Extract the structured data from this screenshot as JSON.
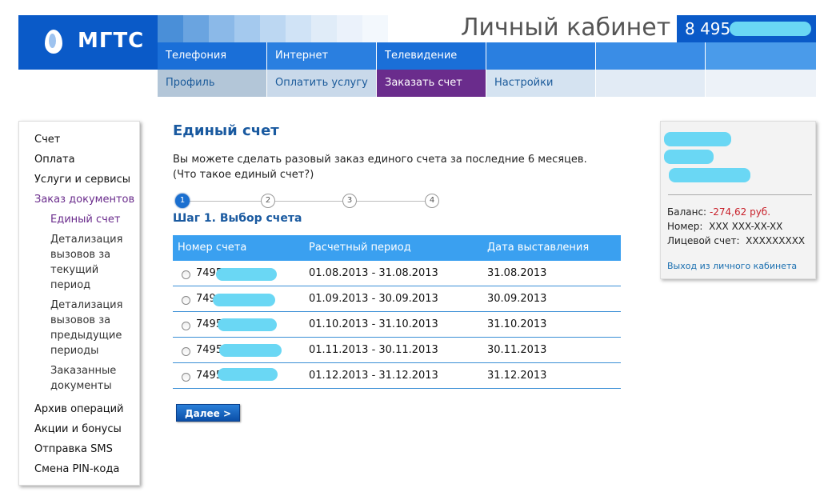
{
  "brand": {
    "logo_text": "МГТС",
    "brand_color": "#0a5ac8"
  },
  "header": {
    "title": "Личный кабинет",
    "phone": "8 495"
  },
  "nav_primary": [
    {
      "label": "Телефония"
    },
    {
      "label": "Интернет"
    },
    {
      "label": "Телевидение"
    }
  ],
  "nav_secondary": [
    {
      "label": "Профиль"
    },
    {
      "label": "Оплатить услугу"
    },
    {
      "label": "Заказать счет"
    },
    {
      "label": "Настройки"
    }
  ],
  "sidebar": {
    "items": [
      {
        "label": "Счет"
      },
      {
        "label": "Оплата"
      },
      {
        "label": "Услуги и сервисы"
      },
      {
        "label": "Заказ документов"
      },
      {
        "label": "Архив операций"
      },
      {
        "label": "Акции и бонусы"
      },
      {
        "label": "Отправка SMS"
      },
      {
        "label": "Смена PIN-кода"
      }
    ],
    "subitems": [
      {
        "label": "Единый счет"
      },
      {
        "label": "Детализация вызовов за текущий период"
      },
      {
        "label": "Детализация вызовов за предыдущие периоды"
      },
      {
        "label": "Заказанные документы"
      }
    ]
  },
  "main": {
    "title": "Единый счет",
    "intro_line1": "Вы можете сделать разовый заказ единого счета за последние 6 месяцев.",
    "intro_line2": "(Что такое единый счет?)",
    "steps": [
      "1",
      "2",
      "3",
      "4"
    ],
    "active_step": 1,
    "step_heading": "Шаг 1. Выбор счета",
    "table": {
      "headers": [
        "Номер счета",
        "Расчетный период",
        "Дата выставления"
      ],
      "rows": [
        {
          "account": "7495",
          "period": "01.08.2013 - 31.08.2013",
          "date": "31.08.2013"
        },
        {
          "account": "749",
          "period": "01.09.2013 - 30.09.2013",
          "date": "30.09.2013"
        },
        {
          "account": "7495",
          "period": "01.10.2013 - 31.10.2013",
          "date": "31.10.2013"
        },
        {
          "account": "7495",
          "period": "01.11.2013 - 30.11.2013",
          "date": "30.11.2013"
        },
        {
          "account": "7495",
          "period": "01.12.2013 - 31.12.2013",
          "date": "31.12.2013"
        }
      ]
    },
    "next_button": "Далее >"
  },
  "user": {
    "balance_label": "Баланс:",
    "balance_value": "-274,62 руб.",
    "number_label": "Номер:",
    "number_value": "XXX XXX-XX-XX",
    "account_label": "Лицевой счет:",
    "account_value": "XXXXXXXXX",
    "logout": "Выход из личного кабинета"
  },
  "colors": {
    "accent": "#0a5ac8",
    "table_header": "#3aa0f0",
    "active_tab": "#6a2c8c",
    "negative": "#c8202a"
  }
}
